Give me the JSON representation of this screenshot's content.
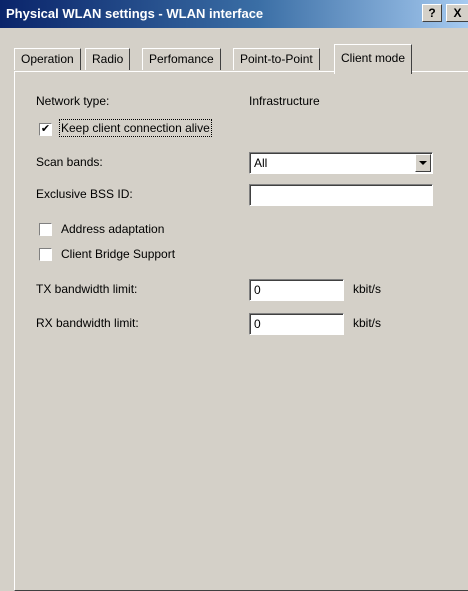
{
  "window": {
    "title": "Physical WLAN settings - WLAN interface",
    "help_label": "?",
    "close_label": "X"
  },
  "tabs": [
    "Operation",
    "Radio",
    "Perfomance",
    "Point-to-Point",
    "Client mode"
  ],
  "active_tab": "Client mode",
  "form": {
    "network_type_label": "Network type:",
    "network_type_value": "Infrastructure",
    "keep_alive_label": "Keep client connection alive",
    "keep_alive_checked": true,
    "scan_bands_label": "Scan bands:",
    "scan_bands_value": "All",
    "bss_id_label": "Exclusive BSS ID:",
    "bss_id_value": "",
    "address_adaptation_label": "Address adaptation",
    "address_adaptation_checked": false,
    "client_bridge_label": "Client Bridge Support",
    "client_bridge_checked": false,
    "tx_label": "TX bandwidth limit:",
    "tx_value": "0",
    "tx_unit": "kbit/s",
    "rx_label": "RX bandwidth limit:",
    "rx_value": "0",
    "rx_unit": "kbit/s",
    "check_mark": "✔"
  }
}
